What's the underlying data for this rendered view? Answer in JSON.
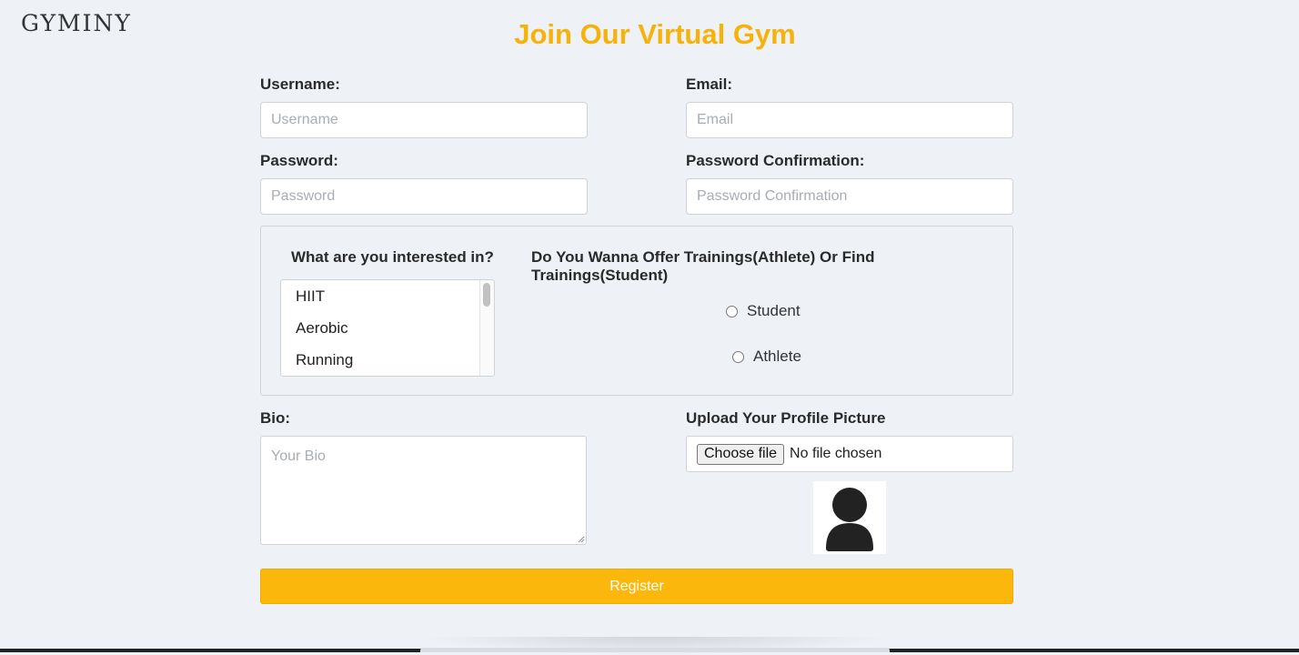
{
  "brand": "GYMINY",
  "title": "Join Our Virtual Gym",
  "fields": {
    "username": {
      "label": "Username:",
      "placeholder": "Username"
    },
    "email": {
      "label": "Email:",
      "placeholder": "Email"
    },
    "password": {
      "label": "Password:",
      "placeholder": "Password"
    },
    "password_confirmation": {
      "label": "Password Confirmation:",
      "placeholder": "Password Confirmation"
    }
  },
  "interests": {
    "label": "What are you interested in?",
    "options": [
      "HIIT",
      "Aerobic",
      "Running"
    ]
  },
  "role": {
    "label": "Do You Wanna Offer Trainings(Athlete) Or Find Trainings(Student)",
    "options": [
      "Student",
      "Athlete"
    ]
  },
  "bio": {
    "label": "Bio:",
    "placeholder": "Your Bio"
  },
  "upload": {
    "label": "Upload Your Profile Picture",
    "button": "Choose file",
    "status": "No file chosen"
  },
  "register_label": "Register",
  "colors": {
    "accent": "#f5b20a",
    "button": "#fbb70c",
    "background": "#eef2f7"
  }
}
